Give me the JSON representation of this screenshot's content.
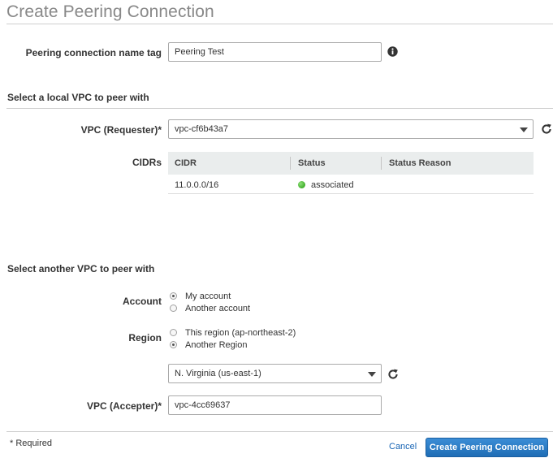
{
  "page_title": "Create Peering Connection",
  "name_tag": {
    "label": "Peering connection name tag",
    "value": "Peering Test",
    "info_icon": "info-icon"
  },
  "local_section": {
    "title": "Select a local VPC to peer with",
    "vpc_label": "VPC (Requester)*",
    "vpc_value": "vpc-cf6b43a7",
    "refresh_icon": "refresh-icon",
    "cidrs_label": "CIDRs",
    "table": {
      "columns": [
        "CIDR",
        "Status",
        "Status Reason"
      ],
      "rows": [
        {
          "cidr": "11.0.0.0/16",
          "status": "associated",
          "status_reason": "",
          "status_color": "#3fae2a"
        }
      ]
    }
  },
  "another_section": {
    "title": "Select another VPC to peer with",
    "account_label": "Account",
    "account_options": [
      {
        "label": "My account",
        "checked": true
      },
      {
        "label": "Another account",
        "checked": false
      }
    ],
    "region_label": "Region",
    "region_options": [
      {
        "label": "This region (ap-northeast-2)",
        "checked": false
      },
      {
        "label": "Another Region",
        "checked": true
      }
    ],
    "region_select_value": "N. Virginia (us-east-1)",
    "vpc_label": "VPC (Accepter)*",
    "vpc_value": "vpc-4cc69637"
  },
  "footer": {
    "required_note": "* Required",
    "cancel_label": "Cancel",
    "create_label": "Create Peering Connection"
  },
  "colors": {
    "primary_button": "#1f6db5",
    "link": "#1a66b5",
    "status_ok": "#3fae2a",
    "title_gray": "#888888"
  }
}
